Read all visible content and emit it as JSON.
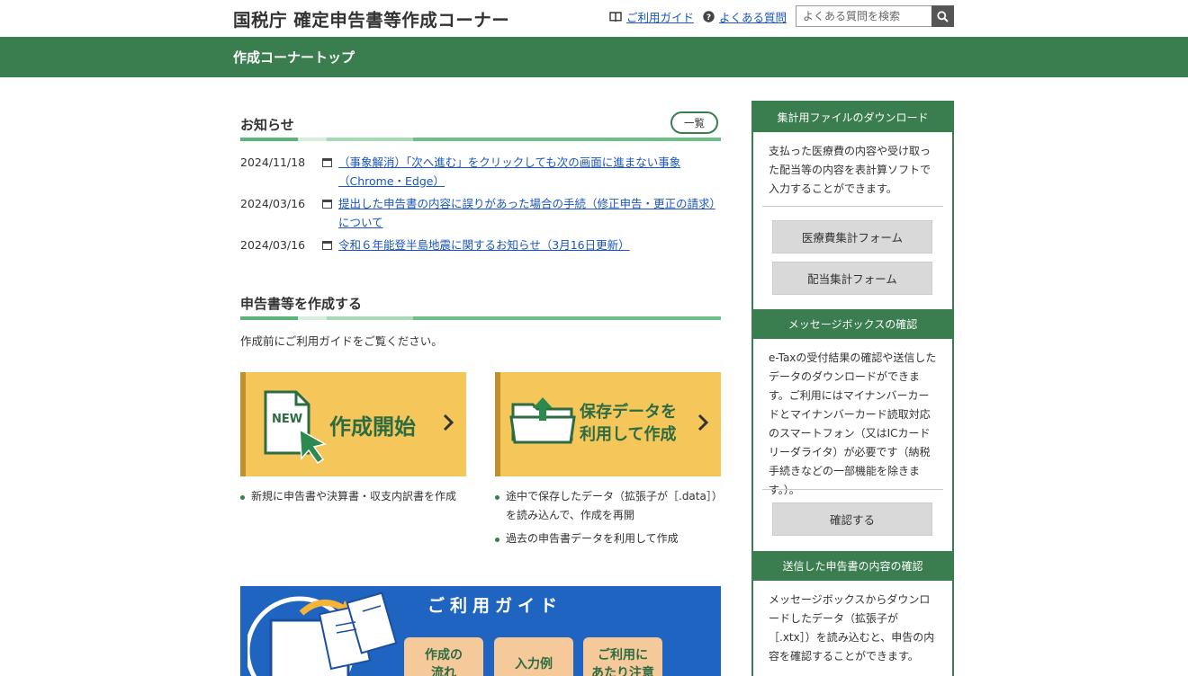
{
  "header": {
    "title": "国税庁 確定申告書等作成コーナー",
    "guide_link": "ご利用ガイド",
    "faq_link": "よくある質問",
    "search_placeholder": "よくある質問を検索"
  },
  "nav": {
    "current": "作成コーナートップ"
  },
  "notices": {
    "heading": "お知らせ",
    "more_label": "一覧",
    "items": [
      {
        "date": "2024/11/18",
        "text": "（事象解消）「次へ進む」をクリックしても次の画面に進まない事象（Chrome・Edge）"
      },
      {
        "date": "2024/03/16",
        "text": "提出した申告書の内容に誤りがあった場合の手続（修正申告・更正の請求）について"
      },
      {
        "date": "2024/03/16",
        "text": "令和６年能登半島地震に関するお知らせ（3月16日更新）"
      }
    ]
  },
  "create": {
    "heading": "申告書等を作成する",
    "lead": "作成前にご利用ガイドをご覧ください。",
    "new_card": {
      "badge": "NEW",
      "title": "作成開始"
    },
    "saved_card": {
      "title_line1": "保存データを",
      "title_line2": "利用して作成"
    },
    "new_bullets": [
      "新規に申告書や決算書・収支内訳書を作成"
    ],
    "saved_bullets": [
      "途中で保存したデータ（拡張子が［.data］）を読み込んで、作成を再開",
      "過去の申告書データを利用して作成"
    ]
  },
  "guide_banner": {
    "title": "ご利用ガイド",
    "btn1_line1": "作成の",
    "btn1_line2": "流れ",
    "btn2_line1": "入力例",
    "btn3_line1": "ご利用に",
    "btn3_line2": "あたり注意"
  },
  "sidebar": {
    "download": {
      "heading": "集計用ファイルのダウンロード",
      "text": "支払った医療費の内容や受け取った配当等の内容を表計算ソフトで入力することができます。",
      "btn_medical": "医療費集計フォーム",
      "btn_dividend": "配当集計フォーム"
    },
    "messagebox": {
      "heading": "メッセージボックスの確認",
      "text": "e-Taxの受付結果の確認や送信したデータのダウンロードができます。ご利用にはマイナンバーカードとマイナンバーカード読取対応のスマートフォン（又はICカードリーダライタ）が必要です（納税手続きなどの一部機能を除きます。）。",
      "btn": "確認する"
    },
    "sent": {
      "heading": "送信した申告書の内容の確認",
      "text": "メッセージボックスからダウンロードしたデータ（拡張子が［.xtx］）を読み込むと、申告の内容を確認することができます。"
    }
  },
  "colors": {
    "brand_green": "#3a7d4e",
    "card_yellow": "#f5c65a",
    "guide_blue": "#2064c2",
    "link_blue": "#1a55c0"
  }
}
